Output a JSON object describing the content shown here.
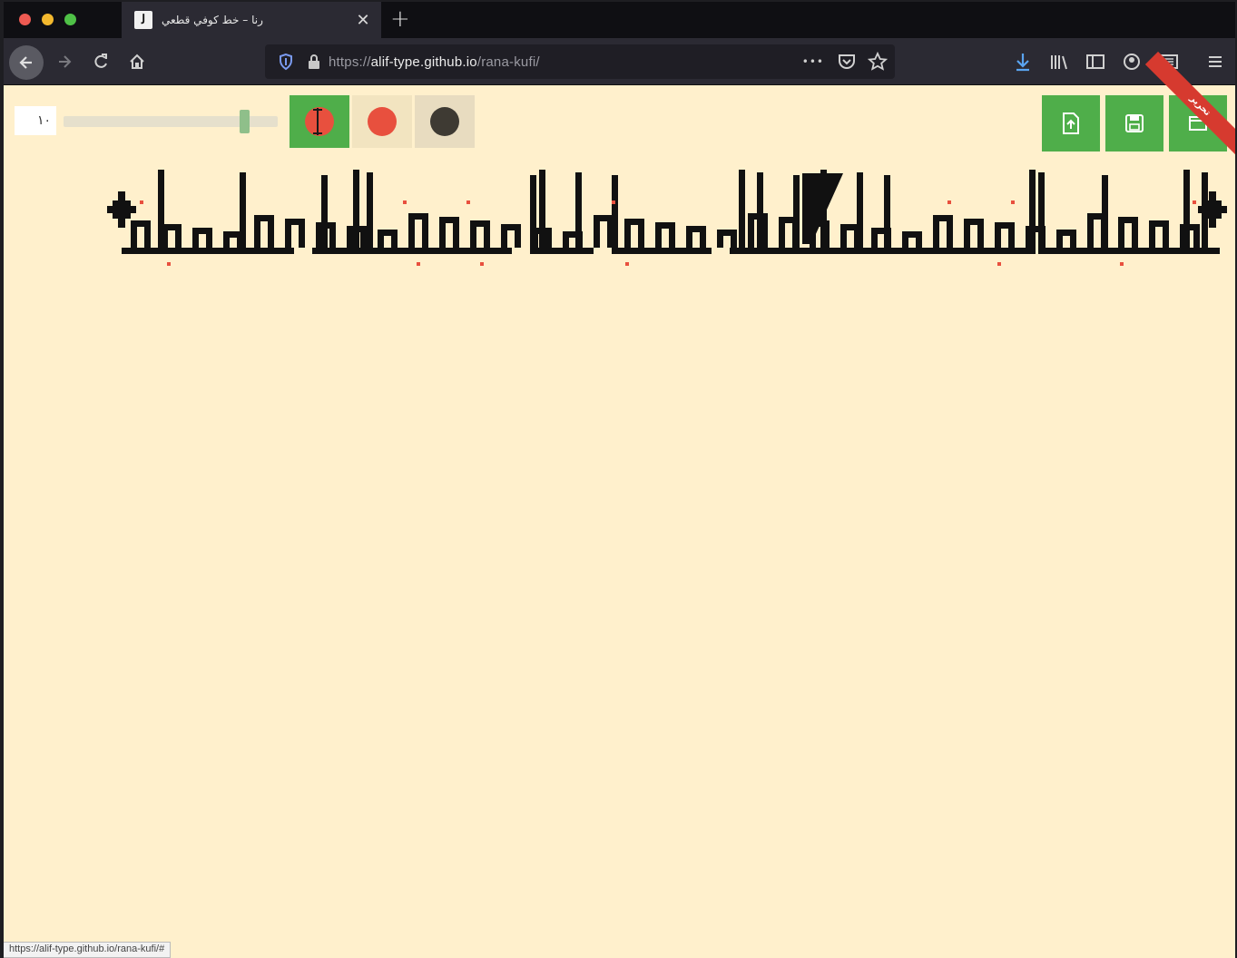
{
  "browser": {
    "tab": {
      "favicon_glyph": "ﻟ",
      "title": "رنا – خط كوفي قطعي",
      "close_glyph": "✕"
    },
    "new_tab_glyph": "+",
    "url": {
      "scheme": "https://",
      "host": "alif-type.github.io",
      "path": "/rana-kufi/"
    },
    "more_glyph": "•••",
    "status_url": "https://alif-type.github.io/rana-kufi/#"
  },
  "editor": {
    "size_value": "١٠",
    "slider_level": 0.88,
    "tools": [
      {
        "name": "red-dot-move-tool",
        "color": "#e8503e",
        "active": true
      },
      {
        "name": "red-dot-tool",
        "color": "#e8503e",
        "active": false
      },
      {
        "name": "dark-dot-tool",
        "color": "#3e3a33",
        "active": false
      }
    ],
    "actions": [
      {
        "name": "upload-button",
        "icon": "upload-icon"
      },
      {
        "name": "save-button",
        "icon": "save-icon"
      },
      {
        "name": "window-button",
        "icon": "window-icon"
      }
    ],
    "ribbon_text": "تحرير",
    "colors": {
      "page_bg": "#fff0cc",
      "accent_green": "#4fae4a",
      "dot_red": "#e8503e",
      "dot_dark": "#3e3a33",
      "ink": "#111111"
    }
  }
}
